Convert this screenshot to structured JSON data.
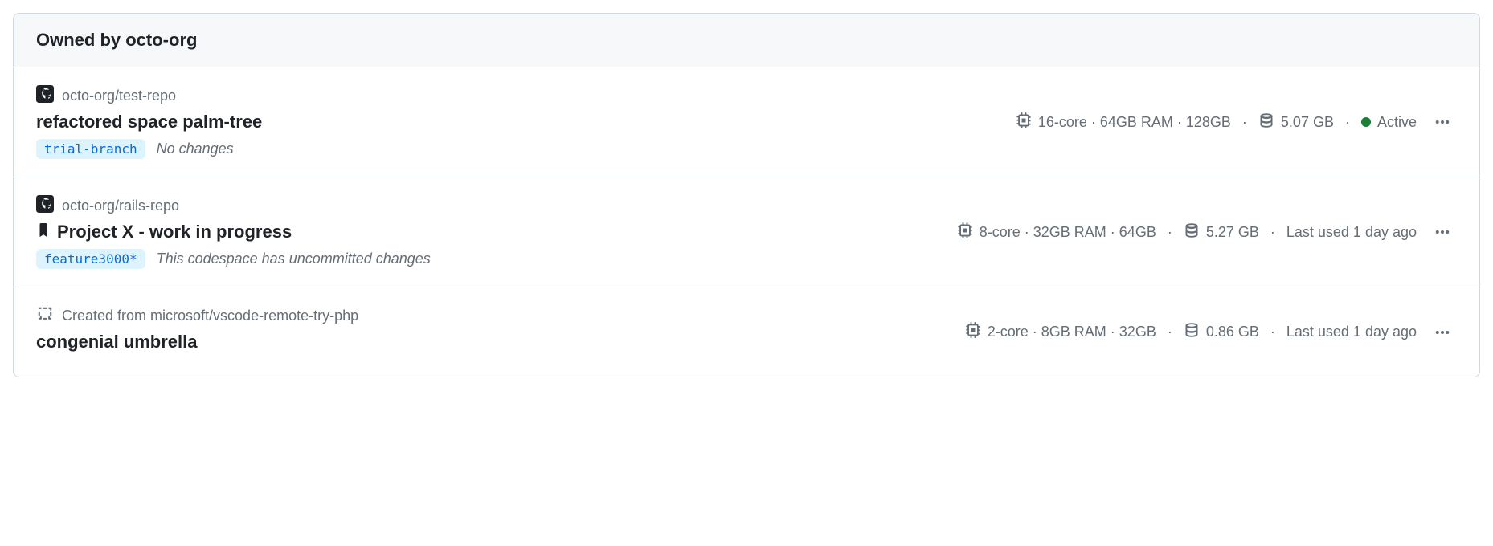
{
  "panel": {
    "title": "Owned by octo-org"
  },
  "items": [
    {
      "repo": "octo-org/test-repo",
      "title": "refactored space palm-tree",
      "bookmarked": false,
      "from_template": false,
      "branch": "trial-branch",
      "branch_status": "No changes",
      "specs": "16-core · 64GB RAM · 128GB",
      "disk": "5.07 GB",
      "status_text": "Active",
      "status_active": true
    },
    {
      "repo": "octo-org/rails-repo",
      "title": "Project X - work in progress",
      "bookmarked": true,
      "from_template": false,
      "branch": "feature3000*",
      "branch_status": "This codespace has uncommitted changes",
      "specs": "8-core · 32GB RAM · 64GB",
      "disk": "5.27 GB",
      "status_text": "Last used 1 day ago",
      "status_active": false
    },
    {
      "repo": "Created from microsoft/vscode-remote-try-php",
      "title": "congenial umbrella",
      "bookmarked": false,
      "from_template": true,
      "branch": "",
      "branch_status": "",
      "specs": "2-core · 8GB RAM · 32GB",
      "disk": "0.86 GB",
      "status_text": "Last used 1 day ago",
      "status_active": false
    }
  ]
}
